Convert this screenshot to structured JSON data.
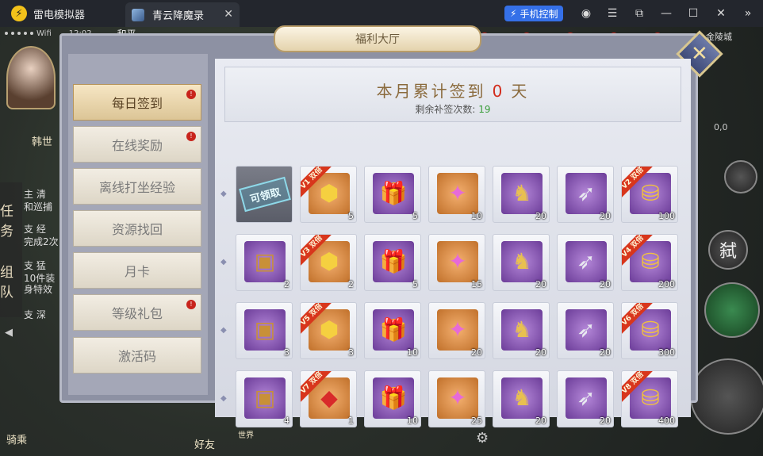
{
  "window": {
    "app_name": "雷电模拟器",
    "tab_title": "青云降魔录",
    "control_button": "手机控制"
  },
  "game_status": {
    "signal": "Wifi",
    "time": "12:02",
    "zone": "和平",
    "location": "金陵城",
    "coords": "0,0"
  },
  "game_side": {
    "player_name": "韩世",
    "quest_tab": "任务",
    "team_tab": "组队",
    "mount_label": "骑乘",
    "friend_label": "好友",
    "world_label": "世界",
    "skill_label": "弑",
    "quest_lines": [
      "主 清",
      "和巡捕",
      "支 经",
      "完成2次",
      "支 猛",
      "10件装",
      "身特效",
      "支 深"
    ]
  },
  "panel": {
    "title": "福利大厅",
    "menu": [
      {
        "label": "每日签到",
        "active": true,
        "badge": true
      },
      {
        "label": "在线奖励",
        "active": false,
        "badge": true
      },
      {
        "label": "离线打坐经验",
        "active": false,
        "badge": false
      },
      {
        "label": "资源找回",
        "active": false,
        "badge": false
      },
      {
        "label": "月卡",
        "active": false,
        "badge": false
      },
      {
        "label": "等级礼包",
        "active": false,
        "badge": true
      },
      {
        "label": "激活码",
        "active": false,
        "badge": false
      }
    ],
    "header": {
      "title_prefix": "本月累计签到",
      "days": "0",
      "title_suffix": "天",
      "sub_prefix": "剩余补签次数:",
      "sub_count": "19"
    },
    "claim_label": "可领取",
    "grid": [
      [
        {
          "icon": "claim-stamp",
          "qty": "",
          "ribbon": ""
        },
        {
          "icon": "gold-gem-icon",
          "qty": "5",
          "ribbon": "V1 双倍"
        },
        {
          "icon": "red-gift-icon",
          "qty": "5",
          "ribbon": ""
        },
        {
          "icon": "pink-crystal-icon",
          "qty": "10",
          "ribbon": ""
        },
        {
          "icon": "gold-horse-icon",
          "qty": "20",
          "ribbon": ""
        },
        {
          "icon": "feather-icon",
          "qty": "20",
          "ribbon": ""
        },
        {
          "icon": "gold-ingot-icon",
          "qty": "100",
          "ribbon": "V2 双倍"
        }
      ],
      [
        {
          "icon": "chest-icon",
          "qty": "2",
          "ribbon": ""
        },
        {
          "icon": "gold-gem-icon",
          "qty": "2",
          "ribbon": "V3 双倍"
        },
        {
          "icon": "red-gift-icon",
          "qty": "5",
          "ribbon": ""
        },
        {
          "icon": "pink-crystal-icon",
          "qty": "15",
          "ribbon": ""
        },
        {
          "icon": "gold-horse-icon",
          "qty": "20",
          "ribbon": ""
        },
        {
          "icon": "feather-icon",
          "qty": "20",
          "ribbon": ""
        },
        {
          "icon": "gold-ingot-icon",
          "qty": "200",
          "ribbon": "V4 双倍"
        }
      ],
      [
        {
          "icon": "chest-icon",
          "qty": "3",
          "ribbon": ""
        },
        {
          "icon": "gold-gem-icon",
          "qty": "3",
          "ribbon": "V5 双倍"
        },
        {
          "icon": "red-gift-icon",
          "qty": "10",
          "ribbon": ""
        },
        {
          "icon": "pink-crystal-icon",
          "qty": "20",
          "ribbon": ""
        },
        {
          "icon": "gold-horse-icon",
          "qty": "20",
          "ribbon": ""
        },
        {
          "icon": "feather-icon",
          "qty": "20",
          "ribbon": ""
        },
        {
          "icon": "gold-ingot-icon",
          "qty": "300",
          "ribbon": "V6 双倍"
        }
      ],
      [
        {
          "icon": "chest-icon",
          "qty": "4",
          "ribbon": ""
        },
        {
          "icon": "red-charm-icon",
          "qty": "1",
          "ribbon": "V7 双倍"
        },
        {
          "icon": "red-gift-icon",
          "qty": "10",
          "ribbon": ""
        },
        {
          "icon": "pink-crystal-icon",
          "qty": "25",
          "ribbon": ""
        },
        {
          "icon": "gold-horse-icon",
          "qty": "20",
          "ribbon": ""
        },
        {
          "icon": "feather-icon",
          "qty": "20",
          "ribbon": ""
        },
        {
          "icon": "gold-ingot-icon",
          "qty": "400",
          "ribbon": "V8 双倍"
        }
      ]
    ]
  }
}
